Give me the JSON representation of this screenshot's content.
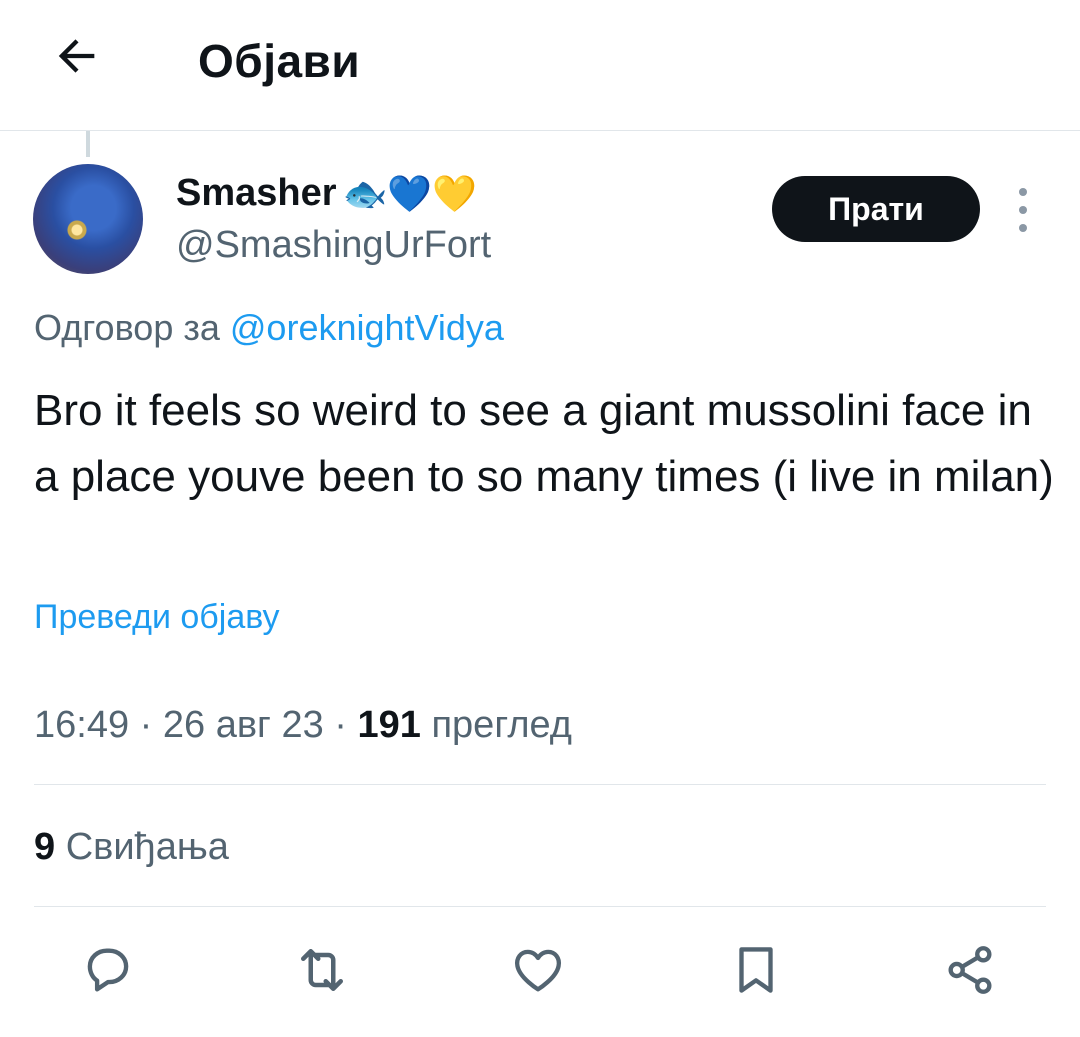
{
  "header": {
    "title": "Објави",
    "back_icon": "arrow-left-icon"
  },
  "tweet": {
    "author_name": "Smasher",
    "name_emojis": "🐟💙💛",
    "handle": "@SmashingUrFort",
    "follow_label": "Прати",
    "reply_prefix": "Одговор за",
    "reply_to": "@oreknightVidya",
    "text": "Bro it feels so weird to see a giant mussolini face in a place youve been to so many times (i live in milan)",
    "translate_label": "Преведи објаву",
    "time": "16:49",
    "date": "26 авг 23",
    "views_count": "191",
    "views_label": "преглед",
    "likes_count": "9",
    "likes_label": "Свиђања"
  },
  "actions": {
    "reply_icon": "reply-icon",
    "retweet_icon": "retweet-icon",
    "like_icon": "heart-icon",
    "bookmark_icon": "bookmark-icon",
    "share_icon": "share-icon"
  },
  "colors": {
    "link": "#1d9bf0",
    "secondary_text": "#536471",
    "primary_text": "#0f1419",
    "follow_bg": "#0f1419"
  }
}
